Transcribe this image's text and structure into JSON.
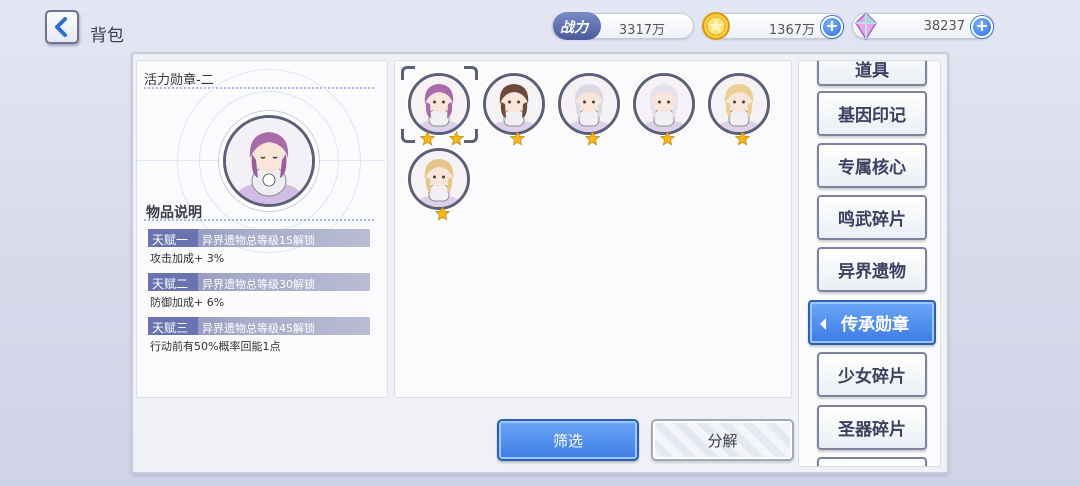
{
  "header": {
    "title": "背包",
    "back_icon": "chevron-left-icon",
    "power_label": "战力",
    "power_value": "3317万",
    "coins_value": "1367万",
    "gems_value": "38237",
    "coin_icon": "gold-coin-icon",
    "gem_icon": "crystal-gem-icon"
  },
  "detail": {
    "item_name": "活力勋章-二",
    "desc_title": "物品说明",
    "talents": [
      {
        "name": "天赋一",
        "condition": "异界遗物总等级15解锁",
        "effect": "攻击加成+ 3%"
      },
      {
        "name": "天赋二",
        "condition": "异界遗物总等级30解锁",
        "effect": "防御加成+ 6%"
      },
      {
        "name": "天赋三",
        "condition": "异界遗物总等级45解锁",
        "effect": "行动前有50%概率回能1点"
      }
    ]
  },
  "items": [
    {
      "id": "c1",
      "stars": 2,
      "selected": true,
      "hair": "#a86aa8"
    },
    {
      "id": "c2",
      "stars": 1,
      "selected": false,
      "hair": "#6b4a3a"
    },
    {
      "id": "c3",
      "stars": 1,
      "selected": false,
      "hair": "#d9dbe0"
    },
    {
      "id": "c4",
      "stars": 1,
      "selected": false,
      "hair": "#e4e2ea"
    },
    {
      "id": "c5",
      "stars": 1,
      "selected": false,
      "hair": "#e9cf96"
    },
    {
      "id": "c6",
      "stars": 1,
      "selected": false,
      "hair": "#e6c48a"
    }
  ],
  "buttons": {
    "filter": "筛选",
    "decompose": "分解"
  },
  "tabs": [
    {
      "label": "道具",
      "active": false
    },
    {
      "label": "基因印记",
      "active": false
    },
    {
      "label": "专属核心",
      "active": false
    },
    {
      "label": "鸣武碎片",
      "active": false
    },
    {
      "label": "异界遗物",
      "active": false
    },
    {
      "label": "传承勋章",
      "active": true
    },
    {
      "label": "少女碎片",
      "active": false
    },
    {
      "label": "圣器碎片",
      "active": false
    },
    {
      "label": "",
      "active": false
    }
  ],
  "colors": {
    "accent_blue": "#3d7ce6",
    "border": "#5b5f78",
    "star": "#f4b81d"
  }
}
